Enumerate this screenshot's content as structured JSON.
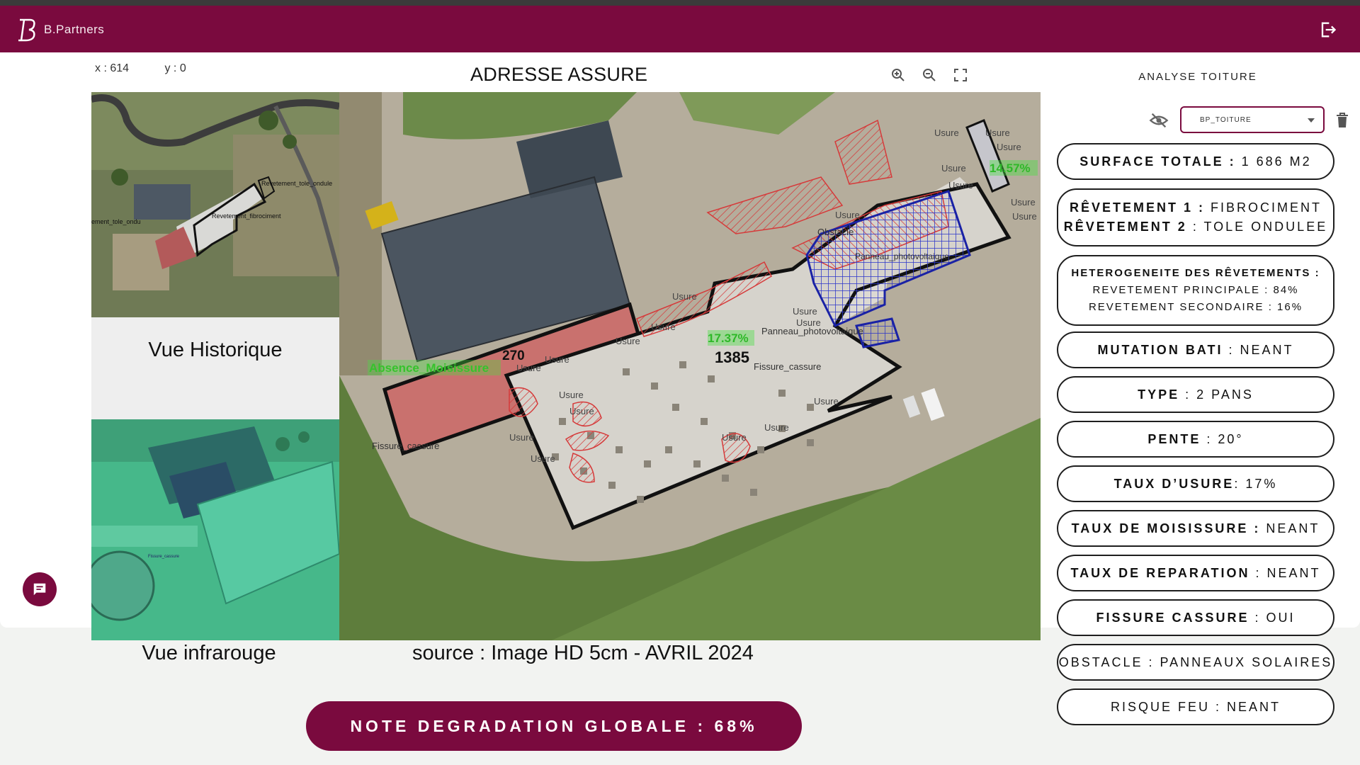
{
  "header": {
    "brand": "B.Partners",
    "logout_icon": "logout-icon"
  },
  "coords": {
    "x_label": "x : 614",
    "y_label": "y : 0"
  },
  "page_title": "ADRESSE ASSURE",
  "map_tools": [
    "zoom-in-icon",
    "zoom-out-icon",
    "fullscreen-icon"
  ],
  "tab_label": "ANALYSE TOITURE",
  "layer_select": {
    "value": "BP_TOITURE"
  },
  "stats": {
    "surface": {
      "label": "SURFACE TOTALE :",
      "value": " 1 686 M2"
    },
    "revetement1": {
      "label": "RÊVETEMENT 1 :",
      "value": " FIBROCIMENT"
    },
    "revetement2": {
      "label": "RÊVETEMENT 2",
      "value": " : TOLE ONDULEE"
    },
    "heterogeneite": {
      "label": "HETEROGENEITE DES RÊVETEMENTS :",
      "line1": "REVETEMENT PRINCIPALE : 84%",
      "line2": "REVETEMENT SECONDAIRE : 16%"
    },
    "mutation": {
      "label": "MUTATION BATI",
      "value": " : NEANT"
    },
    "type": {
      "label": "TYPE",
      "value": " : 2 PANS"
    },
    "pente": {
      "label": "PENTE",
      "value": " : 20°"
    },
    "usure": {
      "label": "TAUX D’USURE",
      "value": ": 17%"
    },
    "moisissure": {
      "label": "TAUX DE MOISISSURE :",
      "value": " NEANT"
    },
    "reparation": {
      "label": "TAUX DE REPARATION",
      "value": " : NEANT"
    },
    "fissure": {
      "label": "FISSURE CASSURE",
      "value": " : OUI"
    },
    "obstacle": {
      "value": "OBSTACLE : PANNEAUX SOLAIRES"
    },
    "feu": {
      "value": "RISQUE FEU : NEANT"
    }
  },
  "views": {
    "historique": "Vue Historique",
    "infrarouge": "Vue infrarouge",
    "source": "source : Image HD 5cm - AVRIL 2024"
  },
  "hist_labels": [
    "Revetement_tole_ondule",
    "Revetement_fibrociment",
    "ement_tole_ondu"
  ],
  "ir_labels": [
    "Fissure_cassure"
  ],
  "map_labels": {
    "absence": "Absence_Moisissure",
    "area_small": "270",
    "area_large": "1385",
    "pct_main": "17.37%",
    "pct_side": "14.57%",
    "obstacle": "Obstacle",
    "panneau": "Panneau_photovoltaique",
    "panneau2": "Panneau_photovoltaique",
    "fissure1": "Fissure_cassure",
    "fissure2": "Fissure_cassure",
    "usure": "Usure"
  },
  "global_note": "NOTE DEGRADATION GLOBALE : 68%",
  "colors": {
    "brand": "#7a0a3e",
    "solar": "#2b35c9",
    "wear": "#d63a3a",
    "pct_badge": "#46e040"
  }
}
